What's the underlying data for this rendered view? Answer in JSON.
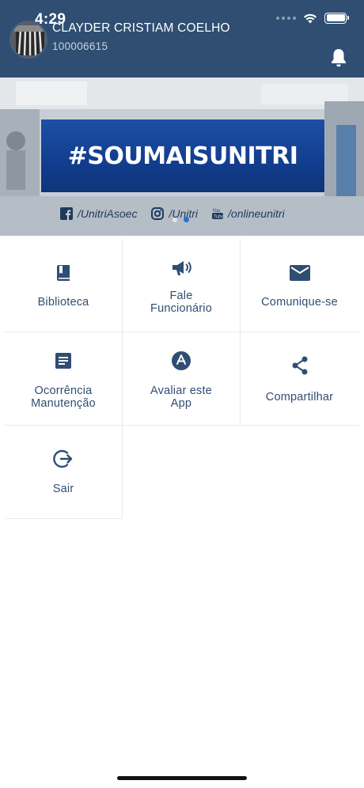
{
  "status_bar": {
    "time": "4:29"
  },
  "header": {
    "user_name": "CLAYDER CRISTIAM COELHO",
    "user_id": "100006615",
    "background": "#2f4e72"
  },
  "banner": {
    "headline": "#SOUMAISUNITRI",
    "social": [
      {
        "icon": "facebook-icon",
        "label": "/UnitriAsoec"
      },
      {
        "icon": "instagram-icon",
        "label": "/Unitri"
      },
      {
        "icon": "youtube-icon",
        "label": "/onlineunitri"
      }
    ],
    "carousel": {
      "pages": 2,
      "current": 2
    }
  },
  "menu": {
    "biblioteca": {
      "icon": "book-icon",
      "label": "Biblioteca"
    },
    "fale": {
      "icon": "megaphone-icon",
      "label": "Fale\nFuncionário"
    },
    "comunique": {
      "icon": "mail-icon",
      "label": "Comunique-se"
    },
    "ocorrencia": {
      "icon": "document-icon",
      "label": "Ocorrência\nManutenção"
    },
    "avaliar": {
      "icon": "app-store-icon",
      "label": "Avaliar este\nApp"
    },
    "compartilhar": {
      "icon": "share-icon",
      "label": "Compartilhar"
    },
    "sair": {
      "icon": "logout-icon",
      "label": "Sair"
    }
  },
  "colors": {
    "accent": "#2f4e72",
    "divider": "#e6e9ee"
  }
}
